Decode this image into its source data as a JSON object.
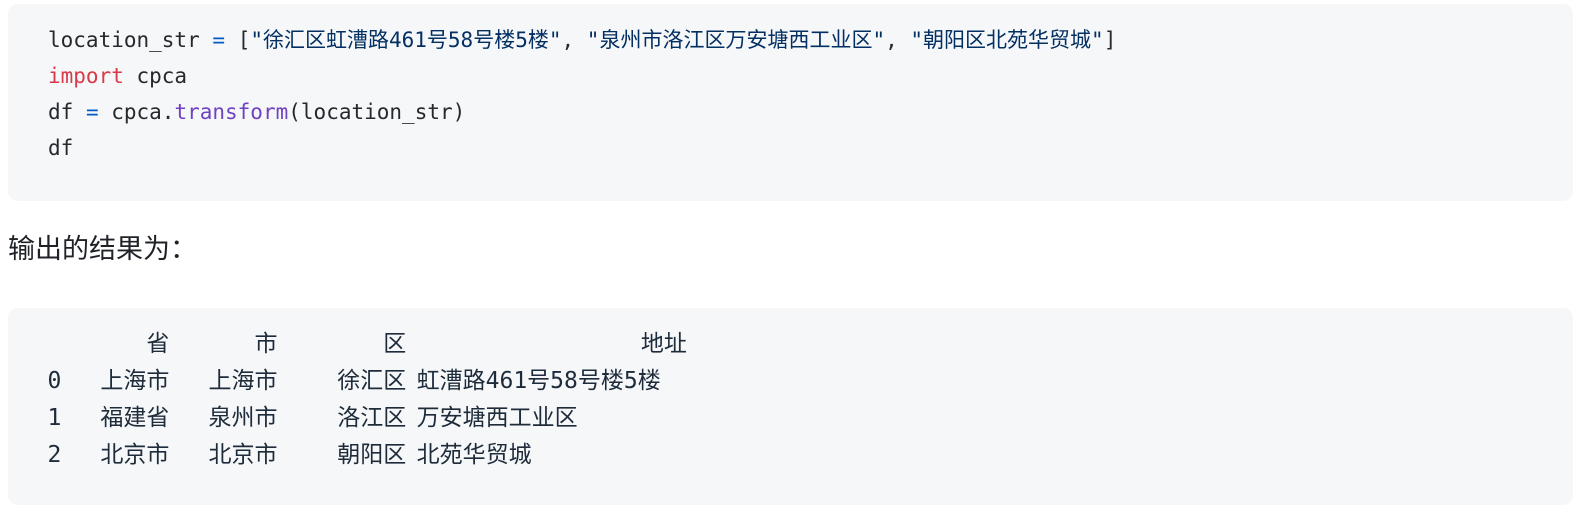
{
  "theme": {
    "page_bg": "#ffffff",
    "code_bg": "#f6f7f9",
    "keyword_color": "#d73a49",
    "operator_color": "#005cc5",
    "function_color": "#6f42c1",
    "string_color": "#032f62",
    "plain_color": "#24292e",
    "text_color": "#1f2328"
  },
  "code_input": {
    "language": "python",
    "lines": [
      {
        "id": "line-1",
        "tokens": [
          {
            "type": "plain",
            "text": "location_str "
          },
          {
            "type": "operator",
            "text": "="
          },
          {
            "type": "plain",
            "text": " "
          },
          {
            "type": "punctuation",
            "text": "["
          },
          {
            "type": "string",
            "text": "\"徐汇区虹漕路461号58号楼5楼\""
          },
          {
            "type": "punctuation",
            "text": ", "
          },
          {
            "type": "string",
            "text": "\"泉州市洛江区万安塘西工业区\""
          },
          {
            "type": "punctuation",
            "text": ", "
          },
          {
            "type": "string",
            "text": "\"朝阳区北苑华贸城\""
          },
          {
            "type": "punctuation",
            "text": "]"
          }
        ]
      },
      {
        "id": "line-2",
        "tokens": [
          {
            "type": "keyword",
            "text": "import"
          },
          {
            "type": "plain",
            "text": " cpca"
          }
        ]
      },
      {
        "id": "line-3",
        "tokens": [
          {
            "type": "plain",
            "text": "df "
          },
          {
            "type": "operator",
            "text": "="
          },
          {
            "type": "plain",
            "text": " cpca."
          },
          {
            "type": "function",
            "text": "transform"
          },
          {
            "type": "punctuation",
            "text": "("
          },
          {
            "type": "plain",
            "text": "location_str"
          },
          {
            "type": "punctuation",
            "text": ")"
          }
        ]
      },
      {
        "id": "line-4",
        "tokens": [
          {
            "type": "plain",
            "text": "df"
          }
        ]
      }
    ]
  },
  "result_label": "输出的结果为：",
  "dataframe": {
    "index_name": "",
    "columns": [
      "省",
      "市",
      "区",
      "地址"
    ],
    "rows": [
      {
        "index": "0",
        "省": "上海市",
        "市": "上海市",
        "区": "徐汇区",
        "地址": "虹漕路461号58号楼5楼"
      },
      {
        "index": "1",
        "省": "福建省",
        "市": "泉州市",
        "区": "洛江区",
        "地址": "万安塘西工业区"
      },
      {
        "index": "2",
        "省": "北京市",
        "市": "北京市",
        "区": "朝阳区",
        "地址": "北苑华贸城"
      }
    ]
  }
}
